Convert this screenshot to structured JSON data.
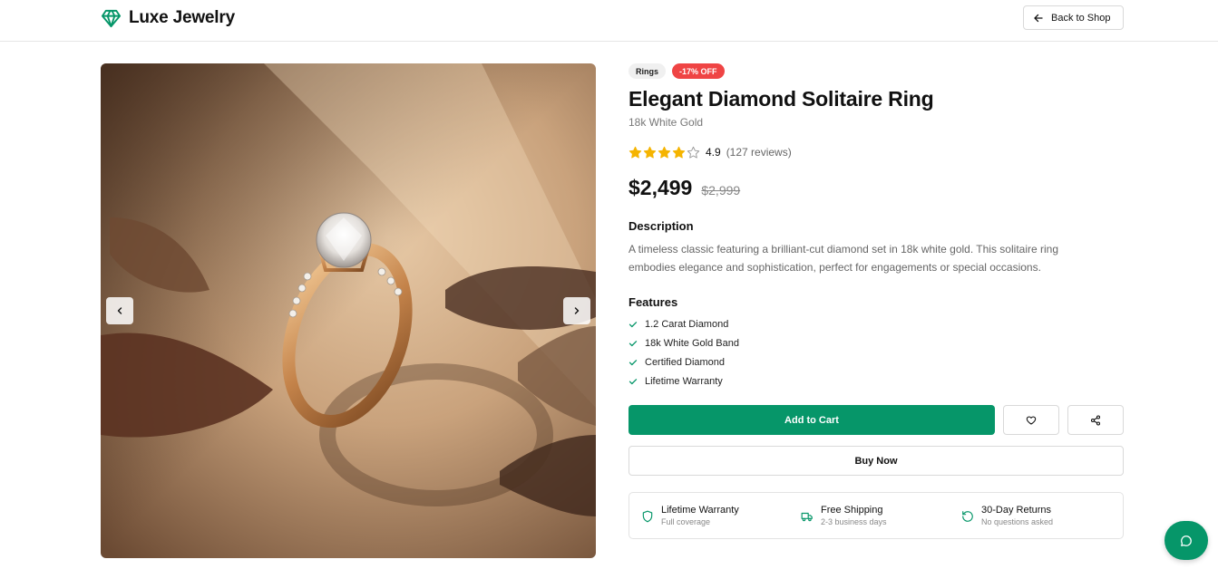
{
  "header": {
    "brand_name": "Luxe Jewelry",
    "back_label": "Back to Shop"
  },
  "gallery": {
    "image_alt": "Elegant Diamond Solitaire Ring on beige surface with dried leaves"
  },
  "product": {
    "category": "Rings",
    "discount": "-17% OFF",
    "title": "Elegant Diamond Solitaire Ring",
    "material": "18k White Gold",
    "rating": 4.9,
    "rating_text": "4.9",
    "reviews_text": "(127 reviews)",
    "price": "$2,499",
    "old_price": "$2,999",
    "description_title": "Description",
    "description": "A timeless classic featuring a brilliant-cut diamond set in 18k white gold. This solitaire ring embodies elegance and sophistication, perfect for engagements or special occasions.",
    "features_title": "Features",
    "features": [
      "1.2 Carat Diamond",
      "18k White Gold Band",
      "Certified Diamond",
      "Lifetime Warranty"
    ]
  },
  "actions": {
    "add_to_cart": "Add to Cart",
    "buy_now": "Buy Now"
  },
  "perks": [
    {
      "title": "Lifetime Warranty",
      "subtitle": "Full coverage",
      "icon": "shield-icon"
    },
    {
      "title": "Free Shipping",
      "subtitle": "2-3 business days",
      "icon": "truck-icon"
    },
    {
      "title": "30-Day Returns",
      "subtitle": "No questions asked",
      "icon": "rotate-icon"
    }
  ],
  "colors": {
    "brand": "#069669",
    "discount": "#ef4444",
    "star": "#f5b400"
  }
}
